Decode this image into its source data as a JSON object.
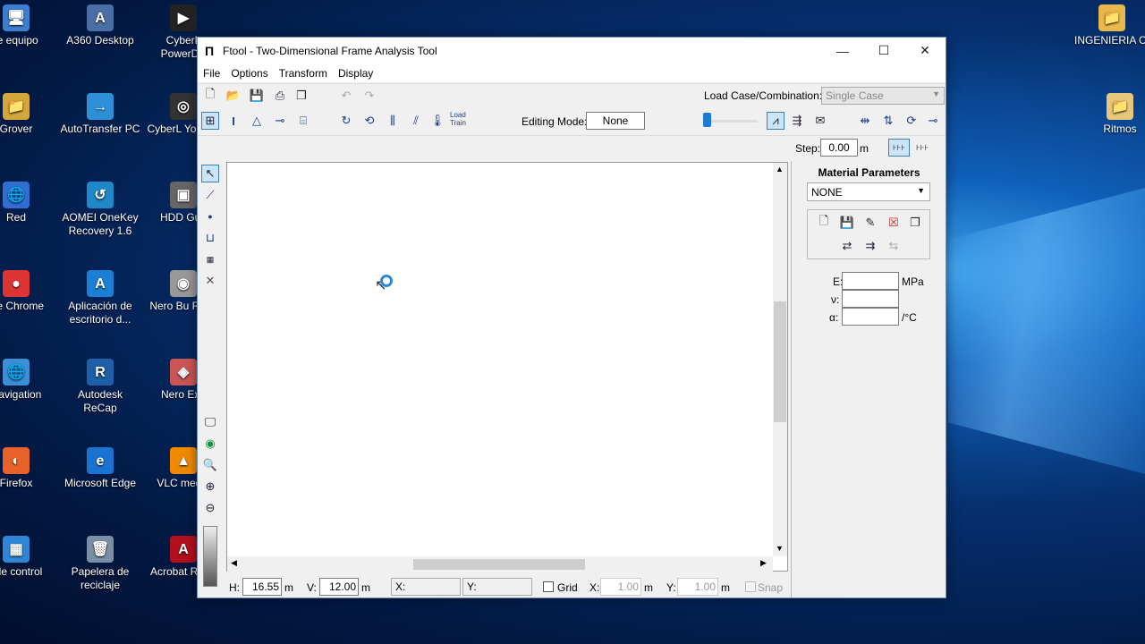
{
  "desktop": {
    "icons": [
      {
        "label": "te equipo",
        "color": "#3b7fd1",
        "glyph": "🖥"
      },
      {
        "label": "A360 Desktop",
        "color": "#4a6fa5",
        "glyph": "A"
      },
      {
        "label": "CyberL PowerDV",
        "color": "#222",
        "glyph": "▶"
      },
      {
        "label": "Grover",
        "color": "#d4a73a",
        "glyph": "📁"
      },
      {
        "label": "AutoTransfer PC",
        "color": "#2d8fd5",
        "glyph": "→"
      },
      {
        "label": "CyberL YouCar",
        "color": "#333",
        "glyph": "◎"
      },
      {
        "label": "Red",
        "color": "#2f6fd1",
        "glyph": "🌐"
      },
      {
        "label": "AOMEI OneKey Recovery 1.6",
        "color": "#1e88c9",
        "glyph": "↺"
      },
      {
        "label": "HDD Gua",
        "color": "#666",
        "glyph": "▣"
      },
      {
        "label": "gle Chrome",
        "color": "#d33",
        "glyph": "●"
      },
      {
        "label": "Aplicación de escritorio d...",
        "color": "#1c7fd6",
        "glyph": "A"
      },
      {
        "label": "Nero Bu ROM",
        "color": "#999",
        "glyph": "◉"
      },
      {
        "label": "Navigation",
        "color": "#3a8fd6",
        "glyph": "🌐"
      },
      {
        "label": "Autodesk ReCap",
        "color": "#1f5fa8",
        "glyph": "R"
      },
      {
        "label": "Nero Exp",
        "color": "#c55",
        "glyph": "◈"
      },
      {
        "label": "Firefox",
        "color": "#e6622a",
        "glyph": "◐"
      },
      {
        "label": "Microsoft Edge",
        "color": "#1a73d1",
        "glyph": "e"
      },
      {
        "label": "VLC media",
        "color": "#f08a00",
        "glyph": "▲"
      },
      {
        "label": "l de control",
        "color": "#2f86d6",
        "glyph": "▦"
      },
      {
        "label": "Papelera de reciclaje",
        "color": "#7a8fa5",
        "glyph": "🗑"
      },
      {
        "label": "Acrobat R DC",
        "color": "#b3101d",
        "glyph": "A"
      },
      {
        "label": "INGENIERIA CI",
        "color": "#e8b84a",
        "glyph": "📁"
      },
      {
        "label": "Ritmos",
        "color": "#e8c77a",
        "glyph": "📁"
      }
    ]
  },
  "window": {
    "title": "Ftool - Two-Dimensional Frame Analysis Tool",
    "menu": [
      "File",
      "Options",
      "Transform",
      "Display"
    ],
    "load_case_label": "Load Case/Combination:",
    "load_case_value": "Single Case",
    "editing_mode_label": "Editing Mode:",
    "editing_mode_value": "None",
    "load_train_label": "Load\nTrain",
    "step_label": "Step:",
    "step_value": "0.00",
    "step_unit": "m",
    "status": {
      "h_label": "H:",
      "h_value": "16.55",
      "h_unit": "m",
      "v_label": "V:",
      "v_value": "12.00",
      "v_unit": "m",
      "x_label": "X:",
      "y_label": "Y:",
      "grid_label": "Grid",
      "gx_label": "X:",
      "gx_value": "1.00",
      "gx_unit": "m",
      "gy_label": "Y:",
      "gy_value": "1.00",
      "gy_unit": "m",
      "snap_label": "Snap"
    },
    "material": {
      "title": "Material Parameters",
      "selected": "NONE",
      "e_label": "E:",
      "e_unit": "MPa",
      "nu_label": "ν:",
      "alpha_label": "α:",
      "alpha_unit": "/°C"
    }
  }
}
